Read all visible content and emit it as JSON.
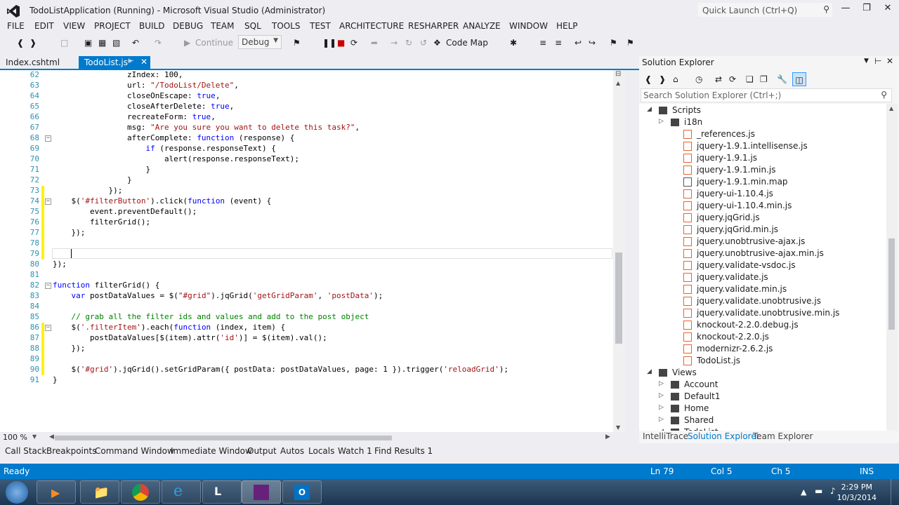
{
  "titlebar": {
    "title": "TodoListApplication (Running) - Microsoft Visual Studio (Administrator)",
    "quick_launch_placeholder": "Quick Launch (Ctrl+Q)"
  },
  "menu": [
    "FILE",
    "EDIT",
    "VIEW",
    "PROJECT",
    "BUILD",
    "DEBUG",
    "TEAM",
    "SQL",
    "TOOLS",
    "TEST",
    "ARCHITECTURE",
    "RESHARPER",
    "ANALYZE",
    "WINDOW",
    "HELP"
  ],
  "toolbar": {
    "continue_label": "Continue",
    "config_value": "Debug",
    "code_map_label": "Code Map"
  },
  "tabs": {
    "index": "Index.cshtml",
    "todo": "TodoList.js*"
  },
  "editor": {
    "lines": [
      {
        "n": "62",
        "t": "                zIndex: 100,"
      },
      {
        "n": "63",
        "t": "                url: \"/TodoList/Delete\","
      },
      {
        "n": "64",
        "t": "                closeOnEscape: true,"
      },
      {
        "n": "65",
        "t": "                closeAfterDelete: true,"
      },
      {
        "n": "66",
        "t": "                recreateForm: true,"
      },
      {
        "n": "67",
        "t": "                msg: \"Are you sure you want to delete this task?\","
      },
      {
        "n": "68",
        "t": "                afterComplete: function (response) {"
      },
      {
        "n": "69",
        "t": "                    if (response.responseText) {"
      },
      {
        "n": "70",
        "t": "                        alert(response.responseText);"
      },
      {
        "n": "71",
        "t": "                    }"
      },
      {
        "n": "72",
        "t": "                }"
      },
      {
        "n": "73",
        "t": "            });"
      },
      {
        "n": "74",
        "t": "    $('#filterButton').click(function (event) {"
      },
      {
        "n": "75",
        "t": "        event.preventDefault();"
      },
      {
        "n": "76",
        "t": "        filterGrid();"
      },
      {
        "n": "77",
        "t": "    });"
      },
      {
        "n": "78",
        "t": ""
      },
      {
        "n": "79",
        "t": ""
      },
      {
        "n": "80",
        "t": "});"
      },
      {
        "n": "81",
        "t": ""
      },
      {
        "n": "82",
        "t": "function filterGrid() {"
      },
      {
        "n": "83",
        "t": "    var postDataValues = $(\"#grid\").jqGrid('getGridParam', 'postData');"
      },
      {
        "n": "84",
        "t": ""
      },
      {
        "n": "85",
        "t": "    // grab all the filter ids and values and add to the post object"
      },
      {
        "n": "86",
        "t": "    $('.filterItem').each(function (index, item) {"
      },
      {
        "n": "87",
        "t": "        postDataValues[$(item).attr('id')] = $(item).val();"
      },
      {
        "n": "88",
        "t": "    });"
      },
      {
        "n": "89",
        "t": ""
      },
      {
        "n": "90",
        "t": "    $('#grid').jqGrid().setGridParam({ postData: postDataValues, page: 1 }).trigger('reloadGrid');"
      },
      {
        "n": "91",
        "t": "}"
      }
    ],
    "zoom": "100 %"
  },
  "solution_explorer": {
    "title": "Solution Explorer",
    "search_placeholder": "Search Solution Explorer (Ctrl+;)",
    "tree": [
      {
        "label": "Scripts",
        "level": 2,
        "kind": "folder",
        "arrow": "open"
      },
      {
        "label": "i18n",
        "level": 3,
        "kind": "folder",
        "arrow": "closed"
      },
      {
        "label": "_references.js",
        "level": 4,
        "kind": "js"
      },
      {
        "label": "jquery-1.9.1.intellisense.js",
        "level": 4,
        "kind": "js"
      },
      {
        "label": "jquery-1.9.1.js",
        "level": 4,
        "kind": "js"
      },
      {
        "label": "jquery-1.9.1.min.js",
        "level": 4,
        "kind": "js"
      },
      {
        "label": "jquery-1.9.1.min.map",
        "level": 4,
        "kind": "file"
      },
      {
        "label": "jquery-ui-1.10.4.js",
        "level": 4,
        "kind": "js"
      },
      {
        "label": "jquery-ui-1.10.4.min.js",
        "level": 4,
        "kind": "js"
      },
      {
        "label": "jquery.jqGrid.js",
        "level": 4,
        "kind": "js"
      },
      {
        "label": "jquery.jqGrid.min.js",
        "level": 4,
        "kind": "js"
      },
      {
        "label": "jquery.unobtrusive-ajax.js",
        "level": 4,
        "kind": "js"
      },
      {
        "label": "jquery.unobtrusive-ajax.min.js",
        "level": 4,
        "kind": "js"
      },
      {
        "label": "jquery.validate-vsdoc.js",
        "level": 4,
        "kind": "js"
      },
      {
        "label": "jquery.validate.js",
        "level": 4,
        "kind": "js"
      },
      {
        "label": "jquery.validate.min.js",
        "level": 4,
        "kind": "js"
      },
      {
        "label": "jquery.validate.unobtrusive.js",
        "level": 4,
        "kind": "js"
      },
      {
        "label": "jquery.validate.unobtrusive.min.js",
        "level": 4,
        "kind": "js"
      },
      {
        "label": "knockout-2.2.0.debug.js",
        "level": 4,
        "kind": "js"
      },
      {
        "label": "knockout-2.2.0.js",
        "level": 4,
        "kind": "js"
      },
      {
        "label": "modernizr-2.6.2.js",
        "level": 4,
        "kind": "js"
      },
      {
        "label": "TodoList.js",
        "level": 4,
        "kind": "js"
      },
      {
        "label": "Views",
        "level": 2,
        "kind": "folder",
        "arrow": "open"
      },
      {
        "label": "Account",
        "level": 3,
        "kind": "folder",
        "arrow": "closed"
      },
      {
        "label": "Default1",
        "level": 3,
        "kind": "folder",
        "arrow": "closed"
      },
      {
        "label": "Home",
        "level": 3,
        "kind": "folder",
        "arrow": "closed"
      },
      {
        "label": "Shared",
        "level": 3,
        "kind": "folder",
        "arrow": "closed"
      },
      {
        "label": "TodoList",
        "level": 3,
        "kind": "folder",
        "arrow": "open"
      }
    ],
    "bottom_tabs": [
      "IntelliTrace",
      "Solution Explorer",
      "Team Explorer"
    ]
  },
  "bottom_tabs": [
    "Call Stack",
    "Breakpoints",
    "Command Window",
    "Immediate Window",
    "Output",
    "Autos",
    "Locals",
    "Watch 1",
    "Find Results 1"
  ],
  "status": {
    "ready": "Ready",
    "ln": "Ln 79",
    "col": "Col 5",
    "ch": "Ch 5",
    "ins": "INS"
  },
  "taskbar": {
    "time": "2:29 PM",
    "date": "10/3/2014"
  },
  "colors": {
    "accent": "#007acc",
    "keyword": "#0000ff",
    "string": "#a31515",
    "comment": "#008000"
  }
}
